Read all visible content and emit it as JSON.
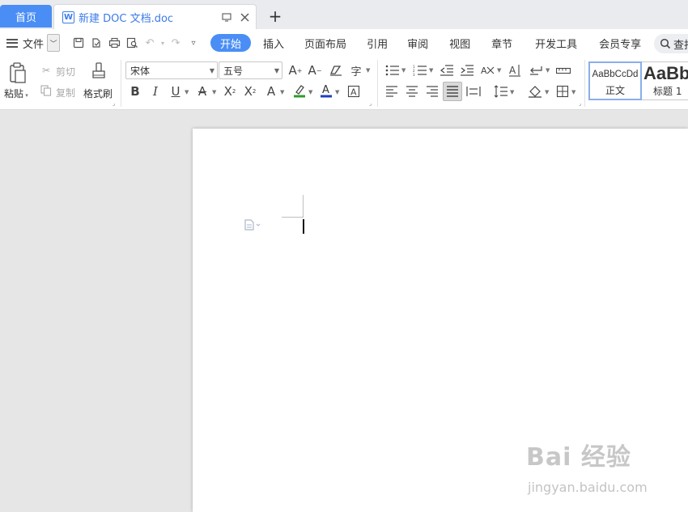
{
  "tabs": {
    "home": "首页",
    "document": "新建 DOC 文档.doc",
    "new_tab": "+"
  },
  "menu": {
    "file": "文件",
    "ribbon_tabs": [
      "开始",
      "插入",
      "页面布局",
      "引用",
      "审阅",
      "视图",
      "章节",
      "开发工具",
      "会员专享"
    ],
    "search": "查找"
  },
  "ribbon": {
    "paste": "粘贴",
    "cut": "剪切",
    "copy": "复制",
    "format_painter": "格式刷",
    "font_name": "宋体",
    "font_size": "五号",
    "styles": [
      {
        "preview": "AaBbCcDd",
        "name": "正文"
      },
      {
        "preview": "AaBb",
        "name": "标题 1"
      }
    ]
  },
  "watermark": {
    "brand": "Bai 经验",
    "url": "jingyan.baidu.com"
  },
  "colors": {
    "accent": "#4a8ef5",
    "font_color_bar": "#1f3fbf",
    "highlight_bar": "#2e9b2e"
  }
}
